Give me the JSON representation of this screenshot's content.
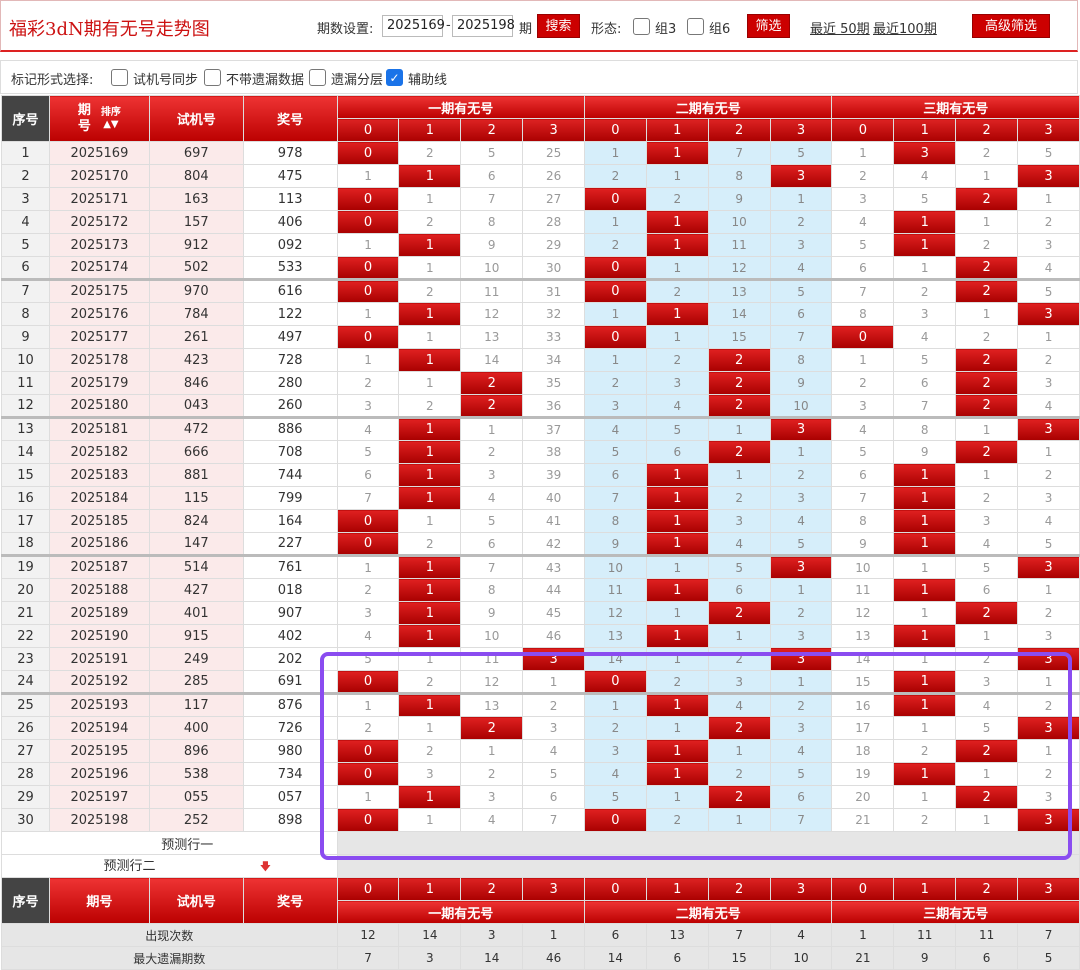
{
  "header": {
    "title": "福彩3dN期有无号走势图",
    "period_label": "期数设置:",
    "period_from": "2025169",
    "period_to": "2025198",
    "period_unit": "期",
    "search_btn": "搜索",
    "form_label": "形态:",
    "group3": "组3",
    "group6": "组6",
    "filter_btn": "筛选",
    "recent50": "最近 50期",
    "recent100": "最近100期",
    "advanced_btn": "高级筛选"
  },
  "options": {
    "label": "标记形式选择:",
    "opt1": "试机号同步",
    "opt2": "不带遗漏数据",
    "opt3": "遗漏分层",
    "opt4": "辅助线",
    "opt4_checked": true
  },
  "table": {
    "col_seq": "序号",
    "col_period": "期号",
    "col_period_a": "期",
    "col_period_b": "号",
    "sort_label": "排序",
    "col_trial": "试机号",
    "col_prize": "奖号",
    "group1": "一期有无号",
    "group2": "二期有无号",
    "group3": "三期有无号",
    "digits": [
      "0",
      "1",
      "2",
      "3",
      "0",
      "1",
      "2",
      "3",
      "0",
      "1",
      "2",
      "3"
    ],
    "rows": [
      {
        "seq": "1",
        "period": "2025169",
        "trial": "697",
        "prize": "978",
        "c": [
          "0",
          "2",
          "5",
          "25",
          "1",
          "1",
          "7",
          "5",
          "1",
          "3",
          "2",
          "5"
        ],
        "h": [
          0,
          5,
          9
        ]
      },
      {
        "seq": "2",
        "period": "2025170",
        "trial": "804",
        "prize": "475",
        "c": [
          "1",
          "1",
          "6",
          "26",
          "2",
          "1",
          "8",
          "3",
          "2",
          "4",
          "1",
          "3"
        ],
        "h": [
          1,
          7,
          11
        ]
      },
      {
        "seq": "3",
        "period": "2025171",
        "trial": "163",
        "prize": "113",
        "c": [
          "0",
          "1",
          "7",
          "27",
          "0",
          "2",
          "9",
          "1",
          "3",
          "5",
          "2",
          "1"
        ],
        "h": [
          0,
          4,
          10
        ]
      },
      {
        "seq": "4",
        "period": "2025172",
        "trial": "157",
        "prize": "406",
        "c": [
          "0",
          "2",
          "8",
          "28",
          "1",
          "1",
          "10",
          "2",
          "4",
          "1",
          "1",
          "2"
        ],
        "h": [
          0,
          5,
          9
        ]
      },
      {
        "seq": "5",
        "period": "2025173",
        "trial": "912",
        "prize": "092",
        "c": [
          "1",
          "1",
          "9",
          "29",
          "2",
          "1",
          "11",
          "3",
          "5",
          "1",
          "2",
          "3"
        ],
        "h": [
          1,
          5,
          9
        ]
      },
      {
        "seq": "6",
        "period": "2025174",
        "trial": "502",
        "prize": "533",
        "c": [
          "0",
          "1",
          "10",
          "30",
          "0",
          "1",
          "12",
          "4",
          "6",
          "1",
          "2",
          "4"
        ],
        "h": [
          0,
          4,
          10
        ]
      },
      {
        "seq": "7",
        "period": "2025175",
        "trial": "970",
        "prize": "616",
        "c": [
          "0",
          "2",
          "11",
          "31",
          "0",
          "2",
          "13",
          "5",
          "7",
          "2",
          "2",
          "5"
        ],
        "h": [
          0,
          4,
          10
        ]
      },
      {
        "seq": "8",
        "period": "2025176",
        "trial": "784",
        "prize": "122",
        "c": [
          "1",
          "1",
          "12",
          "32",
          "1",
          "1",
          "14",
          "6",
          "8",
          "3",
          "1",
          "3"
        ],
        "h": [
          1,
          5,
          11
        ]
      },
      {
        "seq": "9",
        "period": "2025177",
        "trial": "261",
        "prize": "497",
        "c": [
          "0",
          "1",
          "13",
          "33",
          "0",
          "1",
          "15",
          "7",
          "0",
          "4",
          "2",
          "1"
        ],
        "h": [
          0,
          4,
          8
        ]
      },
      {
        "seq": "10",
        "period": "2025178",
        "trial": "423",
        "prize": "728",
        "c": [
          "1",
          "1",
          "14",
          "34",
          "1",
          "2",
          "2",
          "8",
          "1",
          "5",
          "2",
          "2"
        ],
        "h": [
          1,
          6,
          10
        ]
      },
      {
        "seq": "11",
        "period": "2025179",
        "trial": "846",
        "prize": "280",
        "c": [
          "2",
          "1",
          "2",
          "35",
          "2",
          "3",
          "2",
          "9",
          "2",
          "6",
          "2",
          "3"
        ],
        "h": [
          2,
          6,
          10
        ]
      },
      {
        "seq": "12",
        "period": "2025180",
        "trial": "043",
        "prize": "260",
        "c": [
          "3",
          "2",
          "2",
          "36",
          "3",
          "4",
          "2",
          "10",
          "3",
          "7",
          "2",
          "4"
        ],
        "h": [
          2,
          6,
          10
        ]
      },
      {
        "seq": "13",
        "period": "2025181",
        "trial": "472",
        "prize": "886",
        "c": [
          "4",
          "1",
          "1",
          "37",
          "4",
          "5",
          "1",
          "3",
          "4",
          "8",
          "1",
          "3"
        ],
        "h": [
          1,
          7,
          11
        ]
      },
      {
        "seq": "14",
        "period": "2025182",
        "trial": "666",
        "prize": "708",
        "c": [
          "5",
          "1",
          "2",
          "38",
          "5",
          "6",
          "2",
          "1",
          "5",
          "9",
          "2",
          "1"
        ],
        "h": [
          1,
          6,
          10
        ]
      },
      {
        "seq": "15",
        "period": "2025183",
        "trial": "881",
        "prize": "744",
        "c": [
          "6",
          "1",
          "3",
          "39",
          "6",
          "1",
          "1",
          "2",
          "6",
          "1",
          "1",
          "2"
        ],
        "h": [
          1,
          5,
          9
        ]
      },
      {
        "seq": "16",
        "period": "2025184",
        "trial": "115",
        "prize": "799",
        "c": [
          "7",
          "1",
          "4",
          "40",
          "7",
          "1",
          "2",
          "3",
          "7",
          "1",
          "2",
          "3"
        ],
        "h": [
          1,
          5,
          9
        ]
      },
      {
        "seq": "17",
        "period": "2025185",
        "trial": "824",
        "prize": "164",
        "c": [
          "0",
          "1",
          "5",
          "41",
          "8",
          "1",
          "3",
          "4",
          "8",
          "1",
          "3",
          "4"
        ],
        "h": [
          0,
          5,
          9
        ]
      },
      {
        "seq": "18",
        "period": "2025186",
        "trial": "147",
        "prize": "227",
        "c": [
          "0",
          "2",
          "6",
          "42",
          "9",
          "1",
          "4",
          "5",
          "9",
          "1",
          "4",
          "5"
        ],
        "h": [
          0,
          5,
          9
        ]
      },
      {
        "seq": "19",
        "period": "2025187",
        "trial": "514",
        "prize": "761",
        "c": [
          "1",
          "1",
          "7",
          "43",
          "10",
          "1",
          "5",
          "3",
          "10",
          "1",
          "5",
          "3"
        ],
        "h": [
          1,
          7,
          11
        ]
      },
      {
        "seq": "20",
        "period": "2025188",
        "trial": "427",
        "prize": "018",
        "c": [
          "2",
          "1",
          "8",
          "44",
          "11",
          "1",
          "6",
          "1",
          "11",
          "1",
          "6",
          "1"
        ],
        "h": [
          1,
          5,
          9
        ]
      },
      {
        "seq": "21",
        "period": "2025189",
        "trial": "401",
        "prize": "907",
        "c": [
          "3",
          "1",
          "9",
          "45",
          "12",
          "1",
          "2",
          "2",
          "12",
          "1",
          "2",
          "2"
        ],
        "h": [
          1,
          6,
          10
        ]
      },
      {
        "seq": "22",
        "period": "2025190",
        "trial": "915",
        "prize": "402",
        "c": [
          "4",
          "1",
          "10",
          "46",
          "13",
          "1",
          "1",
          "3",
          "13",
          "1",
          "1",
          "3"
        ],
        "h": [
          1,
          5,
          9
        ]
      },
      {
        "seq": "23",
        "period": "2025191",
        "trial": "249",
        "prize": "202",
        "c": [
          "5",
          "1",
          "11",
          "3",
          "14",
          "1",
          "2",
          "3",
          "14",
          "1",
          "2",
          "3"
        ],
        "h": [
          3,
          7,
          11
        ]
      },
      {
        "seq": "24",
        "period": "2025192",
        "trial": "285",
        "prize": "691",
        "c": [
          "0",
          "2",
          "12",
          "1",
          "0",
          "2",
          "3",
          "1",
          "15",
          "1",
          "3",
          "1"
        ],
        "h": [
          0,
          4,
          9
        ]
      },
      {
        "seq": "25",
        "period": "2025193",
        "trial": "117",
        "prize": "876",
        "c": [
          "1",
          "1",
          "13",
          "2",
          "1",
          "1",
          "4",
          "2",
          "16",
          "1",
          "4",
          "2"
        ],
        "h": [
          1,
          5,
          9
        ]
      },
      {
        "seq": "26",
        "period": "2025194",
        "trial": "400",
        "prize": "726",
        "c": [
          "2",
          "1",
          "2",
          "3",
          "2",
          "1",
          "2",
          "3",
          "17",
          "1",
          "5",
          "3"
        ],
        "h": [
          2,
          6,
          11
        ]
      },
      {
        "seq": "27",
        "period": "2025195",
        "trial": "896",
        "prize": "980",
        "c": [
          "0",
          "2",
          "1",
          "4",
          "3",
          "1",
          "1",
          "4",
          "18",
          "2",
          "2",
          "1"
        ],
        "h": [
          0,
          5,
          10
        ]
      },
      {
        "seq": "28",
        "period": "2025196",
        "trial": "538",
        "prize": "734",
        "c": [
          "0",
          "3",
          "2",
          "5",
          "4",
          "1",
          "2",
          "5",
          "19",
          "1",
          "1",
          "2"
        ],
        "h": [
          0,
          5,
          9
        ]
      },
      {
        "seq": "29",
        "period": "2025197",
        "trial": "055",
        "prize": "057",
        "c": [
          "1",
          "1",
          "3",
          "6",
          "5",
          "1",
          "2",
          "6",
          "20",
          "1",
          "2",
          "3"
        ],
        "h": [
          1,
          6,
          10
        ]
      },
      {
        "seq": "30",
        "period": "2025198",
        "trial": "252",
        "prize": "898",
        "c": [
          "0",
          "1",
          "4",
          "7",
          "0",
          "2",
          "1",
          "7",
          "21",
          "2",
          "1",
          "3"
        ],
        "h": [
          0,
          4,
          11
        ]
      }
    ],
    "predict1": "预测行一",
    "predict2": "预测行二",
    "stat1_label": "出现次数",
    "stat1": [
      "12",
      "14",
      "3",
      "1",
      "6",
      "13",
      "7",
      "4",
      "1",
      "11",
      "11",
      "7"
    ],
    "stat2_label": "最大遗漏期数",
    "stat2": [
      "7",
      "3",
      "14",
      "46",
      "14",
      "6",
      "15",
      "10",
      "21",
      "9",
      "6",
      "5"
    ]
  },
  "colors": {
    "accent": "#cc0000",
    "blue_cell": "#d6eefa",
    "highlight": "#8a4cf0"
  }
}
